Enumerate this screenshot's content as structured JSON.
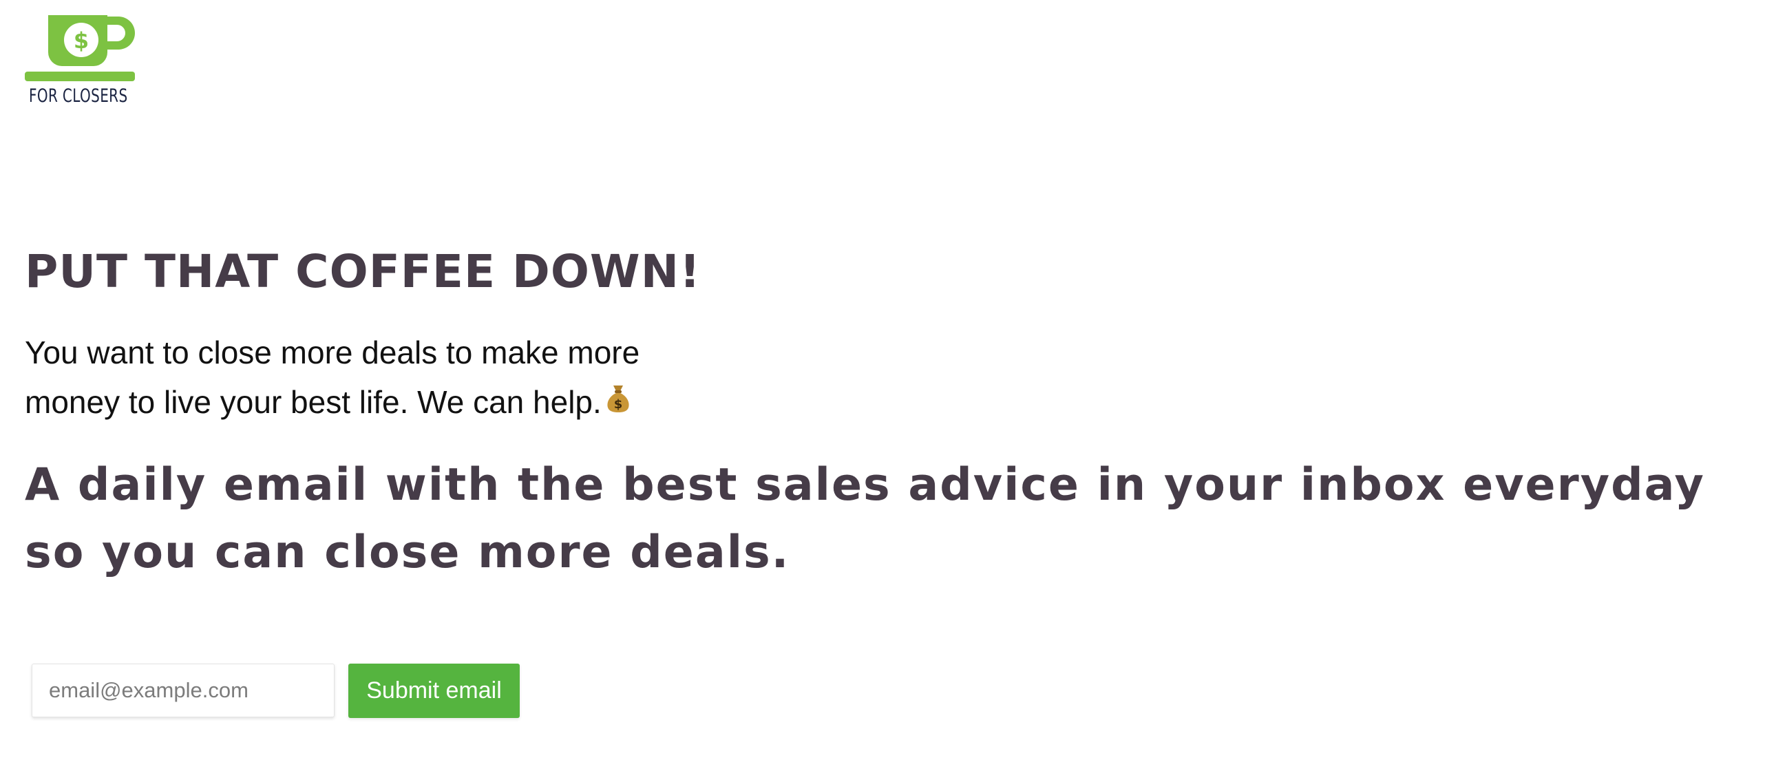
{
  "brand": {
    "logo_text": "FOR CLOSERS",
    "logo_symbol": "$",
    "logo_color": "#7dc242",
    "logo_text_color": "#1b2442"
  },
  "hero": {
    "heading": "PUT THAT COFFEE DOWN!",
    "intro": "You want to close more deals to make more money to live your best life. We can help.",
    "emoji": "💰",
    "emoji_icon": "money-bag-icon",
    "tagline": "A daily email with the best sales advice in your inbox everyday so you can close more deals."
  },
  "signup": {
    "email_placeholder": "email@example.com",
    "email_value": "",
    "submit_label": "Submit email",
    "button_color": "#55b43f"
  },
  "colors": {
    "heading_text": "#463c48",
    "body_text": "#111111",
    "background": "#ffffff"
  }
}
